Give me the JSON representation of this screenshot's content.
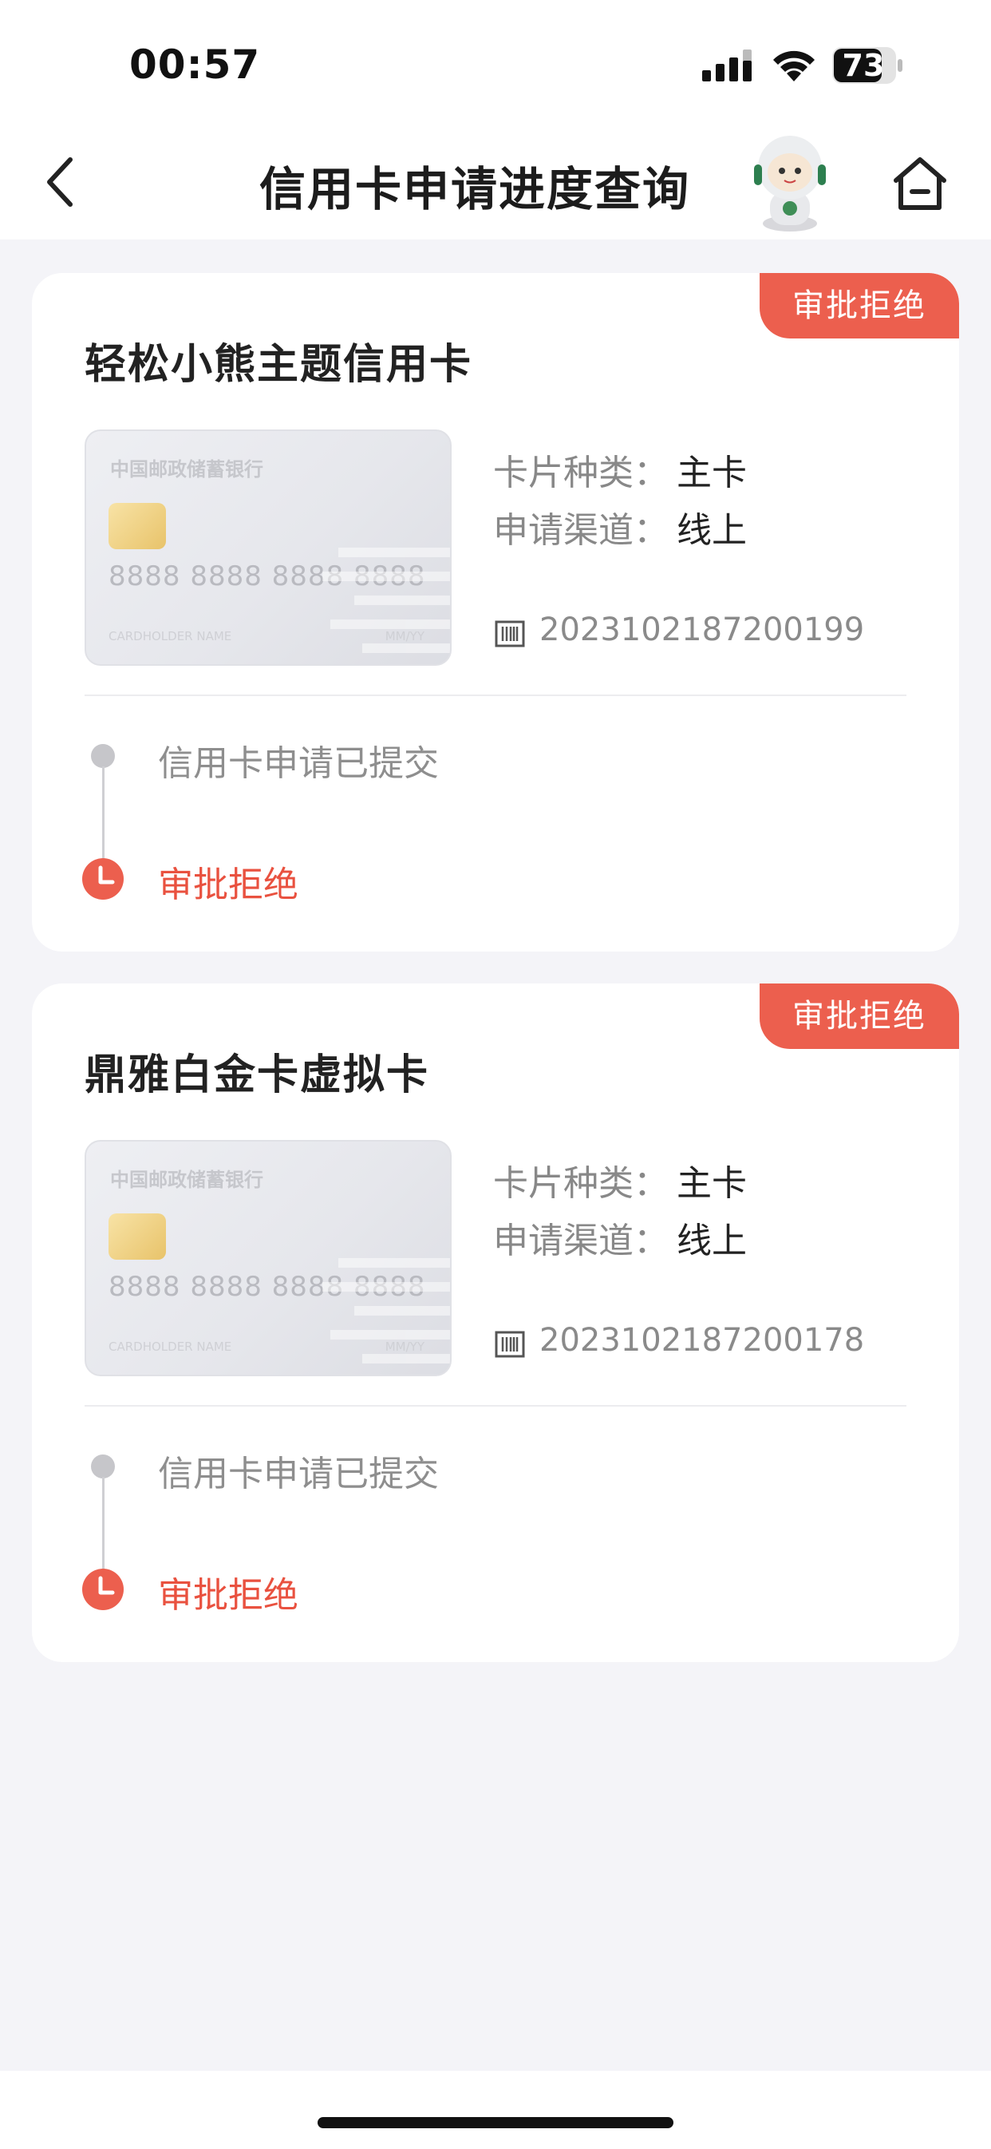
{
  "status_bar": {
    "time": "00:57",
    "battery": "73"
  },
  "nav": {
    "title": "信用卡申请进度查询",
    "back_icon": "chevron-left-icon",
    "assistant_icon": "robot-assistant-icon",
    "home_icon": "home-icon"
  },
  "applications": [
    {
      "status": "审批拒绝",
      "card_name": "轻松小熊主题信用卡",
      "card_image": {
        "bank": "中国邮政储蓄银行",
        "number": "8888 8888 8888 8888",
        "holder": "CARDHOLDER NAME",
        "expiry": "MM/YY"
      },
      "card_type_label": "卡片种类：",
      "card_type_value": "主卡",
      "channel_label": "申请渠道：",
      "channel_value": "线上",
      "application_no": "2023102187200199",
      "timeline": {
        "step1": "信用卡申请已提交",
        "step2": "审批拒绝"
      }
    },
    {
      "status": "审批拒绝",
      "card_name": "鼎雅白金卡虚拟卡",
      "card_image": {
        "bank": "中国邮政储蓄银行",
        "number": "8888 8888 8888 8888",
        "holder": "CARDHOLDER NAME",
        "expiry": "MM/YY"
      },
      "card_type_label": "卡片种类：",
      "card_type_value": "主卡",
      "channel_label": "申请渠道：",
      "channel_value": "线上",
      "application_no": "2023102187200178",
      "timeline": {
        "step1": "信用卡申请已提交",
        "step2": "审批拒绝"
      }
    }
  ],
  "colors": {
    "accent_red": "#ec5f4e",
    "background": "#f4f4f8"
  }
}
